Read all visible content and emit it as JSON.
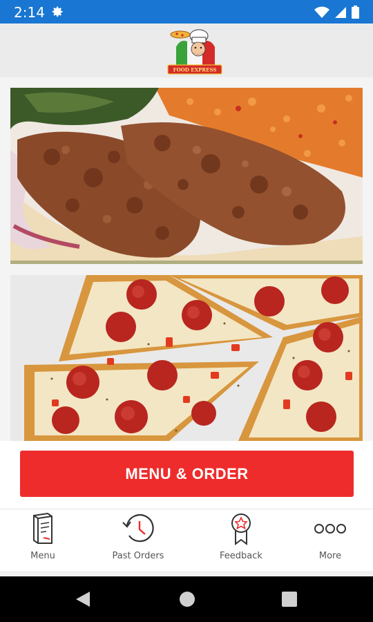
{
  "status_bar": {
    "time": "2:14",
    "icons": [
      "gear-icon",
      "wifi-icon",
      "signal-icon",
      "battery-icon"
    ]
  },
  "header": {
    "logo_text": "FOOD EXPRESS",
    "logo_icon": "chef-logo"
  },
  "content": {
    "images": [
      {
        "name": "kebab-photo",
        "description_icon": "kebab-plate-image"
      },
      {
        "name": "pizza-photo",
        "description_icon": "pepperoni-pizza-image"
      }
    ]
  },
  "cta": {
    "label": "MENU & ORDER",
    "color": "#ee2c2c"
  },
  "bottom_nav": {
    "items": [
      {
        "label": "Menu",
        "icon": "menu-book-icon"
      },
      {
        "label": "Past Orders",
        "icon": "history-clock-icon"
      },
      {
        "label": "Feedback",
        "icon": "award-star-icon"
      },
      {
        "label": "More",
        "icon": "more-dots-icon"
      }
    ]
  },
  "system_nav": {
    "icons": [
      "back-icon",
      "home-icon",
      "recents-icon"
    ]
  },
  "colors": {
    "status_bar": "#1976d2",
    "accent": "#ee2c2c",
    "header_bg": "#ebebeb"
  }
}
